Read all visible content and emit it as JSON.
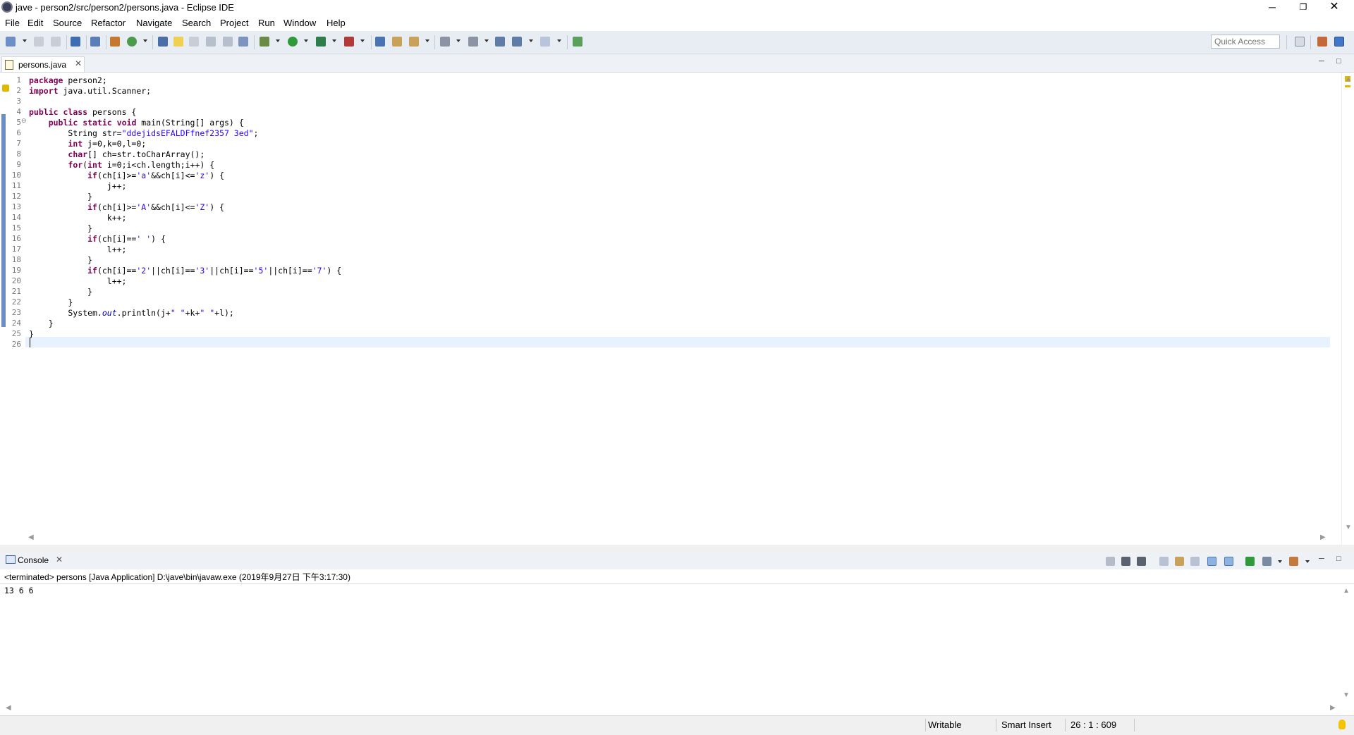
{
  "window": {
    "title": "jave - person2/src/person2/persons.java - Eclipse IDE",
    "minimize": "─",
    "maximize": "❐",
    "close": "✕"
  },
  "menu": [
    "File",
    "Edit",
    "Source",
    "Refactor",
    "Navigate",
    "Search",
    "Project",
    "Run",
    "Window",
    "Help"
  ],
  "toolbar": {
    "quick_access_placeholder": "Quick Access"
  },
  "editor": {
    "tab_label": "persons.java",
    "tab_close": "✕",
    "minimize": "─",
    "maximize": "□",
    "line_numbers": [
      "1",
      "2",
      "3",
      "4",
      "5",
      "6",
      "7",
      "8",
      "9",
      "10",
      "11",
      "12",
      "13",
      "14",
      "15",
      "16",
      "17",
      "18",
      "19",
      "20",
      "21",
      "22",
      "23",
      "24",
      "25",
      "26"
    ],
    "code": [
      [
        {
          "t": "package",
          "c": "kw"
        },
        {
          "t": " person2;"
        }
      ],
      [
        {
          "t": "import",
          "c": "kw"
        },
        {
          "t": " java.util.Scanner;"
        }
      ],
      [
        {
          "t": ""
        }
      ],
      [
        {
          "t": "public",
          "c": "kw"
        },
        {
          "t": " "
        },
        {
          "t": "class",
          "c": "kw"
        },
        {
          "t": " persons {"
        }
      ],
      [
        {
          "t": "    "
        },
        {
          "t": "public",
          "c": "kw"
        },
        {
          "t": " "
        },
        {
          "t": "static",
          "c": "kw"
        },
        {
          "t": " "
        },
        {
          "t": "void",
          "c": "kw"
        },
        {
          "t": " main(String[] args) {"
        }
      ],
      [
        {
          "t": "        String str="
        },
        {
          "t": "\"ddejidsEFALDFfnef2357 3ed\"",
          "c": "str"
        },
        {
          "t": ";"
        }
      ],
      [
        {
          "t": "        "
        },
        {
          "t": "int",
          "c": "kw"
        },
        {
          "t": " j=0,k=0,l=0;"
        }
      ],
      [
        {
          "t": "        "
        },
        {
          "t": "char",
          "c": "kw"
        },
        {
          "t": "[] ch=str.toCharArray();"
        }
      ],
      [
        {
          "t": "        "
        },
        {
          "t": "for",
          "c": "kw"
        },
        {
          "t": "("
        },
        {
          "t": "int",
          "c": "kw"
        },
        {
          "t": " i=0;i<ch.length;i++) {"
        }
      ],
      [
        {
          "t": "            "
        },
        {
          "t": "if",
          "c": "kw"
        },
        {
          "t": "(ch[i]>="
        },
        {
          "t": "'a'",
          "c": "str"
        },
        {
          "t": "&&ch[i]<="
        },
        {
          "t": "'z'",
          "c": "str"
        },
        {
          "t": ") {"
        }
      ],
      [
        {
          "t": "                j++;"
        }
      ],
      [
        {
          "t": "            }"
        }
      ],
      [
        {
          "t": "            "
        },
        {
          "t": "if",
          "c": "kw"
        },
        {
          "t": "(ch[i]>="
        },
        {
          "t": "'A'",
          "c": "str"
        },
        {
          "t": "&&ch[i]<="
        },
        {
          "t": "'Z'",
          "c": "str"
        },
        {
          "t": ") {"
        }
      ],
      [
        {
          "t": "                k++;"
        }
      ],
      [
        {
          "t": "            }"
        }
      ],
      [
        {
          "t": "            "
        },
        {
          "t": "if",
          "c": "kw"
        },
        {
          "t": "(ch[i]=="
        },
        {
          "t": "' '",
          "c": "str"
        },
        {
          "t": ") {"
        }
      ],
      [
        {
          "t": "                l++;"
        }
      ],
      [
        {
          "t": "            }"
        }
      ],
      [
        {
          "t": "            "
        },
        {
          "t": "if",
          "c": "kw"
        },
        {
          "t": "(ch[i]=="
        },
        {
          "t": "'2'",
          "c": "str"
        },
        {
          "t": "||ch[i]=="
        },
        {
          "t": "'3'",
          "c": "str"
        },
        {
          "t": "||ch[i]=="
        },
        {
          "t": "'5'",
          "c": "str"
        },
        {
          "t": "||ch[i]=="
        },
        {
          "t": "'7'",
          "c": "str"
        },
        {
          "t": ") {"
        }
      ],
      [
        {
          "t": "                l++;"
        }
      ],
      [
        {
          "t": "            }"
        }
      ],
      [
        {
          "t": "        }"
        }
      ],
      [
        {
          "t": "        System."
        },
        {
          "t": "out",
          "c": "fld"
        },
        {
          "t": ".println(j+"
        },
        {
          "t": "\" \"",
          "c": "str"
        },
        {
          "t": "+k+"
        },
        {
          "t": "\" \"",
          "c": "str"
        },
        {
          "t": "+l);"
        }
      ],
      [
        {
          "t": "    }"
        }
      ],
      [
        {
          "t": "}"
        }
      ],
      [
        {
          "t": ""
        }
      ]
    ]
  },
  "console": {
    "tab_label": "Console",
    "tab_close": "✕",
    "description": "<terminated> persons [Java Application] D:\\jave\\bin\\javaw.exe (2019年9月27日 下午3:17:30)",
    "output": "13 6 6"
  },
  "status": {
    "writable": "Writable",
    "insert_mode": "Smart Insert",
    "position": "26 : 1 : 609"
  },
  "colors": {
    "keyword": "#7f0055",
    "string": "#2a00ff",
    "field": "#0000c0",
    "current_line": "#e8f2fe",
    "toolbar_bg": "#e8ecf3"
  }
}
